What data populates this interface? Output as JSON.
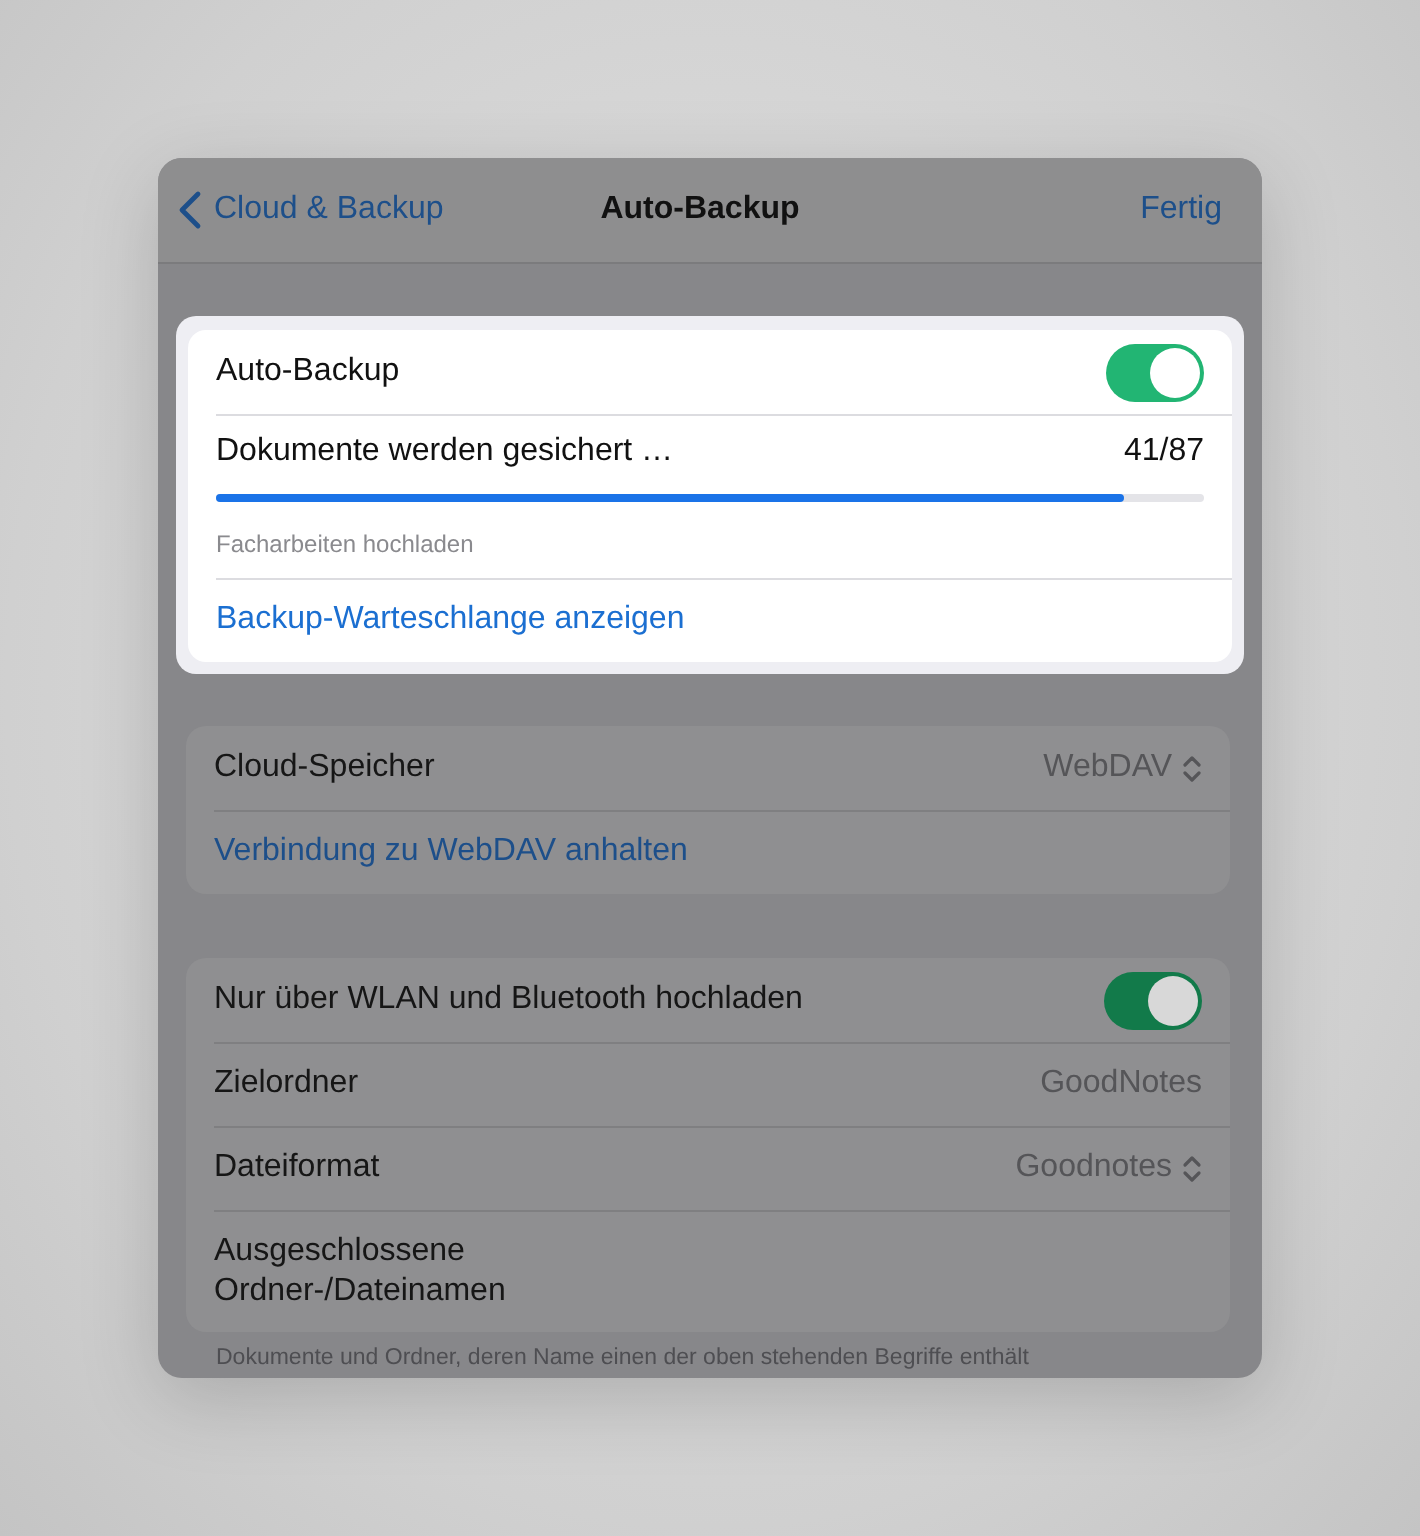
{
  "nav": {
    "back": "Cloud & Backup",
    "title": "Auto-Backup",
    "done": "Fertig"
  },
  "highlight_card": {
    "toggle": {
      "label": "Auto-Backup",
      "on": true
    },
    "progress": {
      "label": "Dokumente werden gesichert …",
      "count": "41/87",
      "level": 0.92
    },
    "caption": "Facharbeiten hochladen",
    "link": "Backup-Warteschlange anzeigen"
  },
  "groups": [
    {
      "rows": [
        {
          "kind": "picker",
          "label": "Cloud-Speicher",
          "value": "WebDAV"
        },
        {
          "kind": "link",
          "label": "Verbindung zu WebDAV anhalten"
        }
      ]
    },
    {
      "rows": [
        {
          "kind": "toggle",
          "label": "Nur über WLAN und Bluetooth hochladen",
          "on": true
        },
        {
          "kind": "value",
          "label": "Zielordner",
          "value": "GoodNotes"
        },
        {
          "kind": "picker",
          "label": "Dateiformat",
          "value": "Goodnotes"
        },
        {
          "kind": "text",
          "label": "Ausgeschlossene\nOrdner-/Dateinamen"
        }
      ]
    }
  ],
  "footer": "Dokumente und Ordner, deren Name einen der oben stehenden Begriffe enthält"
}
